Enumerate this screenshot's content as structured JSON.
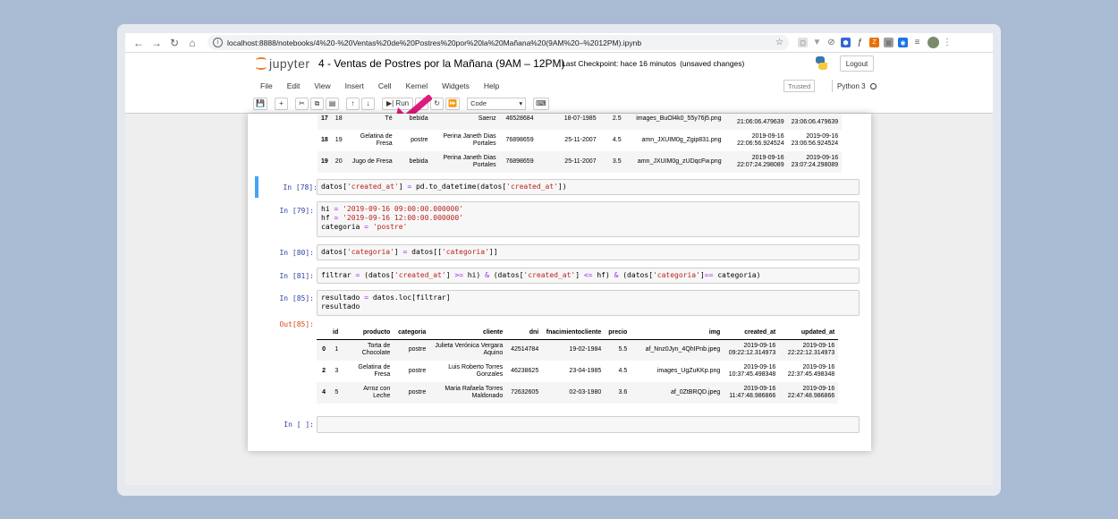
{
  "browser": {
    "url": "localhost:8888/notebooks/4%20-%20Ventas%20de%20Postres%20por%20la%20Mañana%20(9AM%20–%2012PM).ipynb",
    "extensions": [
      {
        "icon": "incognito-icon",
        "color": "#e0e0e0"
      },
      {
        "icon": "shield-icon",
        "color": "#9e9e9e"
      },
      {
        "icon": "circle-slash-icon",
        "color": "#5f6368"
      },
      {
        "icon": "badge-icon",
        "color": "#3367d6"
      },
      {
        "icon": "function-icon",
        "color": "#333333"
      },
      {
        "icon": "z-icon",
        "color": "#e8710a"
      },
      {
        "icon": "grid-icon",
        "color": "#9e9e9e"
      },
      {
        "icon": "target-icon",
        "color": "#1a73e8"
      },
      {
        "icon": "menu-icon",
        "color": "#5f6368"
      }
    ]
  },
  "jupyter": {
    "logo_text": "jupyter",
    "notebook_title": "4 - Ventas de Postres por la Mañana (9AM – 12PM)",
    "checkpoint": "Last Checkpoint: hace 16 minutos",
    "unsaved": "(unsaved changes)",
    "logout_label": "Logout",
    "menu": [
      "File",
      "Edit",
      "View",
      "Insert",
      "Cell",
      "Kernel",
      "Widgets",
      "Help"
    ],
    "trusted_label": "Trusted",
    "kernel_name": "Python 3",
    "toolbar": {
      "run_label": "Run",
      "cell_type": "Code"
    }
  },
  "prev_output": {
    "rows": [
      {
        "idx": "17",
        "id": "18",
        "producto": "Té",
        "categoria": "bebida",
        "cliente": "Saenz",
        "dni": "46528684",
        "fnac": "18-07-1985",
        "precio": "2.5",
        "img": "images_BuOl4k0_55y76j5.png",
        "created": [
          "",
          "21:06:06.479639"
        ],
        "updated": [
          "",
          "23:06:06.479639"
        ]
      },
      {
        "idx": "18",
        "id": "19",
        "producto": [
          "Gelatina de",
          "Fresa"
        ],
        "categoria": "postre",
        "cliente": [
          "Perina Janeth Dias",
          "Portales"
        ],
        "dni": "76898659",
        "fnac": "25-11-2007",
        "precio": "4.5",
        "img": "amn_JXUIM0g_Zgip831.png",
        "created": [
          "2019-09-16",
          "22:06:56.924524"
        ],
        "updated": [
          "2019-09-16",
          "23:06:56.924524"
        ]
      },
      {
        "idx": "19",
        "id": "20",
        "producto": [
          "Jugo de Fresa"
        ],
        "categoria": "bebida",
        "cliente": [
          "Perina Janeth Dias",
          "Portales"
        ],
        "dni": "76898659",
        "fnac": "25-11-2007",
        "precio": "3.5",
        "img": "amn_JXUIM0g_zUDqcFw.png",
        "created": [
          "2019-09-16",
          "22:07:24.298089"
        ],
        "updated": [
          "2019-09-16",
          "23:07:24.298089"
        ]
      }
    ]
  },
  "cells": {
    "c78": {
      "prompt": "In [78]:"
    },
    "c79": {
      "prompt": "In [79]:"
    },
    "c80": {
      "prompt": "In [80]:"
    },
    "c81": {
      "prompt": "In [81]:"
    },
    "c85": {
      "prompt": "In [85]:",
      "line1": "resultado = datos.loc[filtrar]",
      "line2": "resultado"
    },
    "out85": {
      "prompt": "Out[85]:"
    },
    "empty": {
      "prompt": "In [ ]:"
    }
  },
  "result_table": {
    "columns": [
      "id",
      "producto",
      "categoria",
      "cliente",
      "dni",
      "fnacimientocliente",
      "precio",
      "img",
      "created_at",
      "updated_at"
    ],
    "rows": [
      {
        "idx": "0",
        "id": "1",
        "producto": [
          "Torta de",
          "Chocolate"
        ],
        "categoria": "postre",
        "cliente": [
          "Julieta Verónica Vergara",
          "Aquino"
        ],
        "dni": "42514784",
        "fnac": "19-02-1984",
        "precio": "5.5",
        "img": "af_Nnz0Jyn_4QhIPnb.jpeg",
        "created": [
          "2019-09-16",
          "09:22:12.314973"
        ],
        "updated": [
          "2019-09-16",
          "22:22:12.314973"
        ]
      },
      {
        "idx": "2",
        "id": "3",
        "producto": [
          "Gelatina de",
          "Fresa"
        ],
        "categoria": "postre",
        "cliente": [
          "Luis Roberto Torres",
          "Gonzales"
        ],
        "dni": "46238625",
        "fnac": "23-04-1985",
        "precio": "4.5",
        "img": "images_UgZuKKp.png",
        "created": [
          "2019-09-16",
          "10:37:45.498348"
        ],
        "updated": [
          "2019-09-16",
          "22:37:45.498348"
        ]
      },
      {
        "idx": "4",
        "id": "5",
        "producto": [
          "Arroz con",
          "Leche"
        ],
        "categoria": "postre",
        "cliente": [
          "Maria Rafaela Torres",
          "Maldonado"
        ],
        "dni": "72632605",
        "fnac": "02-03-1980",
        "precio": "3.6",
        "img": "af_0ZtBRQD.jpeg",
        "created": [
          "2019-09-16",
          "11:47:48.986866"
        ],
        "updated": [
          "2019-09-16",
          "22:47:48.986866"
        ]
      }
    ]
  },
  "code": {
    "c78": [
      "datos[",
      "'created_at'",
      "] ",
      "=",
      " pd.to_datetime(datos[",
      "'created_at'",
      "])"
    ],
    "c79": [
      "hi ",
      "=",
      " ",
      "'2019-09-16 09:00:00.000000'",
      "hf ",
      "=",
      " ",
      "'2019-09-16 12:00:00.000000'",
      "categoria ",
      "=",
      " ",
      "'postre'"
    ],
    "c80": [
      "datos[",
      "'categoria'",
      "] ",
      "=",
      " datos[[",
      "'categoria'",
      "]]"
    ],
    "c81": [
      "filtrar ",
      "=",
      " (datos[",
      "'created_at'",
      "] ",
      ">=",
      " hi) ",
      "&",
      " (datos[",
      "'created_at'",
      "] ",
      "<=",
      " hf) ",
      "&",
      " (datos[",
      "'categoria'",
      "]",
      "==",
      " categoria)"
    ],
    "c85": [
      "resultado ",
      "=",
      " datos.loc[filtrar]"
    ]
  }
}
